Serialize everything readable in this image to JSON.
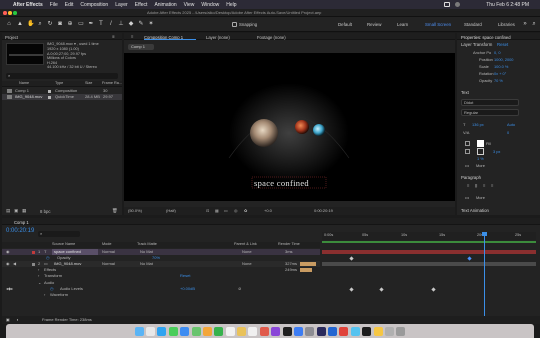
{
  "menubar": {
    "app": "After Effects",
    "menus": [
      "File",
      "Edit",
      "Composition",
      "Layer",
      "Effect",
      "Animation",
      "View",
      "Window",
      "Help"
    ],
    "datetime": "Thu Feb 6  2:48 PM"
  },
  "window_title": "Adobe After Effects 2025 - /Users/aiko/Desktop/Adobe After Effects Auto-Save/Untitled Project.aep",
  "toolbar": {
    "snapping": "Snapping",
    "workspaces": [
      "Default",
      "Review",
      "Learn",
      "Small Screen",
      "Standard",
      "Libraries"
    ],
    "active_workspace": "Small Screen"
  },
  "project": {
    "tab": "Project",
    "footage_info": [
      "IMG_9048.mov ▾ , used 1 time",
      "1920 x 1080 (1.00)",
      "Δ 0;00;27;00, 29.97 fps",
      "Millions of Colors",
      "H.264",
      "44.100 kHz / 32 bit U / Stereo"
    ],
    "search_placeholder": "",
    "columns": [
      "Name",
      "Type",
      "Size",
      "Frame Ra..."
    ],
    "items": [
      {
        "name": "Comp 1",
        "type": "Composition",
        "size": "",
        "fps": "30"
      },
      {
        "name": "IMG_9048.mov",
        "type": "QuickTime",
        "size": "28.4 MB",
        "fps": "29.97"
      }
    ],
    "bpc": "8 bpc"
  },
  "viewer": {
    "tabs": [
      "Composition Comp 1",
      "Layer (none)",
      "Footage (none)"
    ],
    "comp_label": "Comp 1",
    "text_overlay": "space confined",
    "zoom": "(50.0%)",
    "resolution": "(Half)",
    "exposure": "+0.0",
    "timecode": "0:00:20:19"
  },
  "properties": {
    "title": "Properties: space confined",
    "layer_transform": "Layer Transform",
    "reset": "Reset",
    "anchor_point_label": "Anchor Po",
    "anchor_point_value": "0, 0",
    "position_label": "Position",
    "position_value": "1000, 2000",
    "scale_label": "Scale",
    "scale_value": "100.0 %",
    "rotation_label": "Rotation",
    "rotation_value": "0x + 0°",
    "opacity_label": "Opacity",
    "opacity_value": "70 %",
    "text_section": "Text",
    "font": "Didot",
    "font_style": "Regular",
    "font_size": "136 px",
    "tracking": "Auto",
    "leading": "0",
    "fill_label": "Fill",
    "stroke_value": "3 px",
    "stroke_opt": "1 %",
    "more": "More",
    "paragraph": "Paragraph",
    "text_animation": "Text Animation"
  },
  "timeline": {
    "tab": "Comp 1",
    "timecode": "0:00:20:19",
    "columns": {
      "source": "Source Name",
      "mode": "Mode",
      "trkmat": "Track Matte",
      "parent": "Parent & Link",
      "render": "Render Time"
    },
    "layers": [
      {
        "num": "1",
        "name": "space confined",
        "mode": "Normal",
        "matte": "No Mat",
        "parent": "None",
        "render": "3ms"
      },
      {
        "num": "2",
        "name": "IMG_9048.mov",
        "mode": "Normal",
        "matte": "No Mat",
        "parent": "None",
        "render": "327ms"
      }
    ],
    "opacity_sub": "Opacity",
    "opacity_sub_value": "70%",
    "sub_effects": "Effects",
    "sub_transform": "Transform",
    "sub_reset": "Reset",
    "render_249": "249ms",
    "sub_audio": "Audio",
    "sub_audio_levels": "Audio Levels",
    "audio_levels_value": "+0.00dB",
    "sub_waveform": "Waveform",
    "frame_render_label": "Frame Render Time: 238ms",
    "ruler": [
      "0:00s",
      "05s",
      "10s",
      "15s",
      "20s",
      "25s"
    ]
  },
  "colors": {
    "accent": "#3b8fe8",
    "layer_red": "#c23b3b",
    "render_tan": "#c89b62",
    "timeline_green": "#3c8c3c"
  }
}
